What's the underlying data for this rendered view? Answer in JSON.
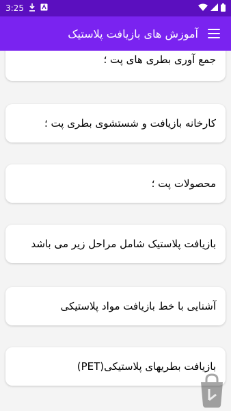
{
  "status_bar": {
    "time": "3:25",
    "left_icons": [
      "download-icon",
      "notification-icon"
    ],
    "right_icons": [
      "wifi-icon",
      "signal-icon",
      "battery-icon"
    ]
  },
  "app_bar": {
    "title": "آموزش های بازیافت پلاستیک",
    "menu_icon": "hamburger-menu-icon"
  },
  "list": {
    "items": [
      {
        "label": "جمع آوری بطری های پت ؛"
      },
      {
        "label": "کارخانه بازیافت و شستشوی بطری پت ؛"
      },
      {
        "label": "محصولات پت ؛"
      },
      {
        "label": "بازیافت پلاستیک شامل مراحل زیر می باشد"
      },
      {
        "label": "آشنایی با خط بازیافت مواد پلاستیکی"
      },
      {
        "label": "بازیافت بطریهای پلاستیکی(PET)"
      }
    ]
  },
  "watermark": {
    "icon": "bazaar-logo-icon"
  },
  "colors": {
    "status_bar": "#5b0fbf",
    "app_bar": "#7a23f0",
    "card_bg": "#ffffff",
    "page_bg": "#f4f4f4"
  }
}
